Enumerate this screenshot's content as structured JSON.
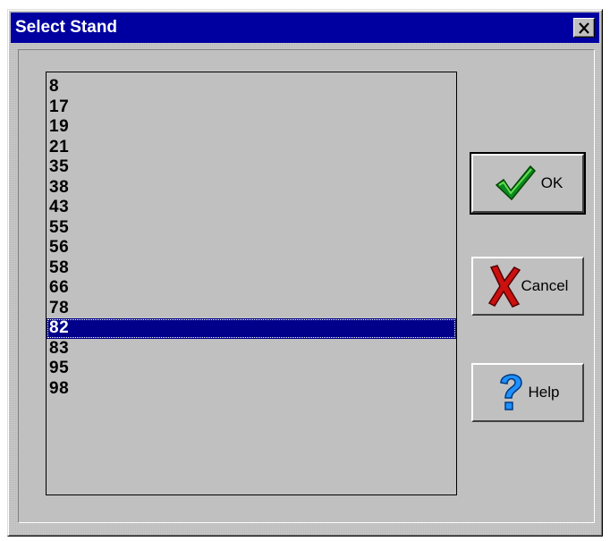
{
  "window": {
    "title": "Select Stand",
    "close_glyph": "×"
  },
  "list": {
    "items": [
      "8",
      "17",
      "19",
      "21",
      "35",
      "38",
      "43",
      "55",
      "56",
      "58",
      "66",
      "78",
      "82",
      "83",
      "95",
      "98"
    ],
    "selected": "82"
  },
  "buttons": {
    "ok": {
      "label": "OK",
      "icon": "green-checkmark-icon"
    },
    "cancel": {
      "label": "Cancel",
      "icon": "red-x-icon"
    },
    "help": {
      "label": "Help",
      "icon": "blue-question-icon"
    }
  },
  "colors": {
    "titlebar": "#0000a0",
    "selection": "#00008b",
    "face": "#c0c0c0"
  }
}
